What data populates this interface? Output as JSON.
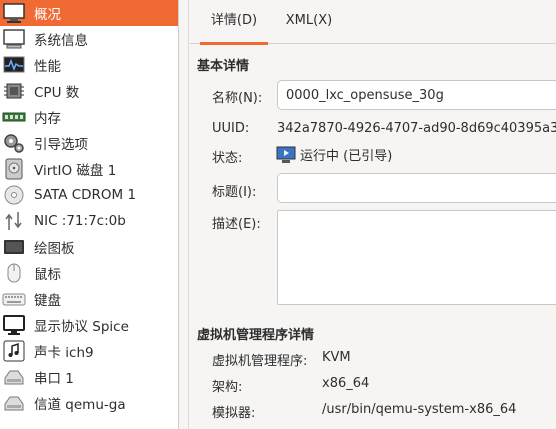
{
  "sidebar": {
    "items": [
      {
        "label": "概况",
        "icon": "overview-icon",
        "selected": true
      },
      {
        "label": "系统信息",
        "icon": "system-info-icon"
      },
      {
        "label": "性能",
        "icon": "performance-icon"
      },
      {
        "label": "CPU 数",
        "icon": "cpu-icon"
      },
      {
        "label": "内存",
        "icon": "memory-icon"
      },
      {
        "label": "引导选项",
        "icon": "boot-options-icon"
      },
      {
        "label": "VirtIO 磁盘 1",
        "icon": "disk-icon"
      },
      {
        "label": "SATA CDROM 1",
        "icon": "cdrom-icon"
      },
      {
        "label": "NIC :71:7c:0b",
        "icon": "network-icon"
      },
      {
        "label": "绘图板",
        "icon": "tablet-icon"
      },
      {
        "label": "鼠标",
        "icon": "mouse-icon"
      },
      {
        "label": "键盘",
        "icon": "keyboard-icon"
      },
      {
        "label": "显示协议 Spice",
        "icon": "display-icon"
      },
      {
        "label": "声卡 ich9",
        "icon": "sound-icon"
      },
      {
        "label": "串口 1",
        "icon": "serial-icon"
      },
      {
        "label": "信道 qemu-ga",
        "icon": "channel-icon"
      }
    ]
  },
  "tabs": {
    "details": "详情(D)",
    "xml": "XML(X)"
  },
  "basic": {
    "title": "基本详情",
    "name_label": "名称(N):",
    "name_value": "0000_lxc_opensuse_30g",
    "uuid_label": "UUID:",
    "uuid_value": "342a7870-4926-4707-ad90-8d69c40395a3",
    "status_label": "状态:",
    "status_value": "运行中 (已引导)",
    "title_label": "标题(I):",
    "title_value": "",
    "desc_label": "描述(E):",
    "desc_value": ""
  },
  "hypervisor": {
    "title": "虚拟机管理程序详情",
    "hv_label": "虚拟机管理程序:",
    "hv_value": "KVM",
    "arch_label": "架构:",
    "arch_value": "x86_64",
    "emulator_label": "模拟器:",
    "emulator_value": "/usr/bin/qemu-system-x86_64"
  },
  "colors": {
    "accent": "#f06b34",
    "background": "#f6f5f4"
  }
}
